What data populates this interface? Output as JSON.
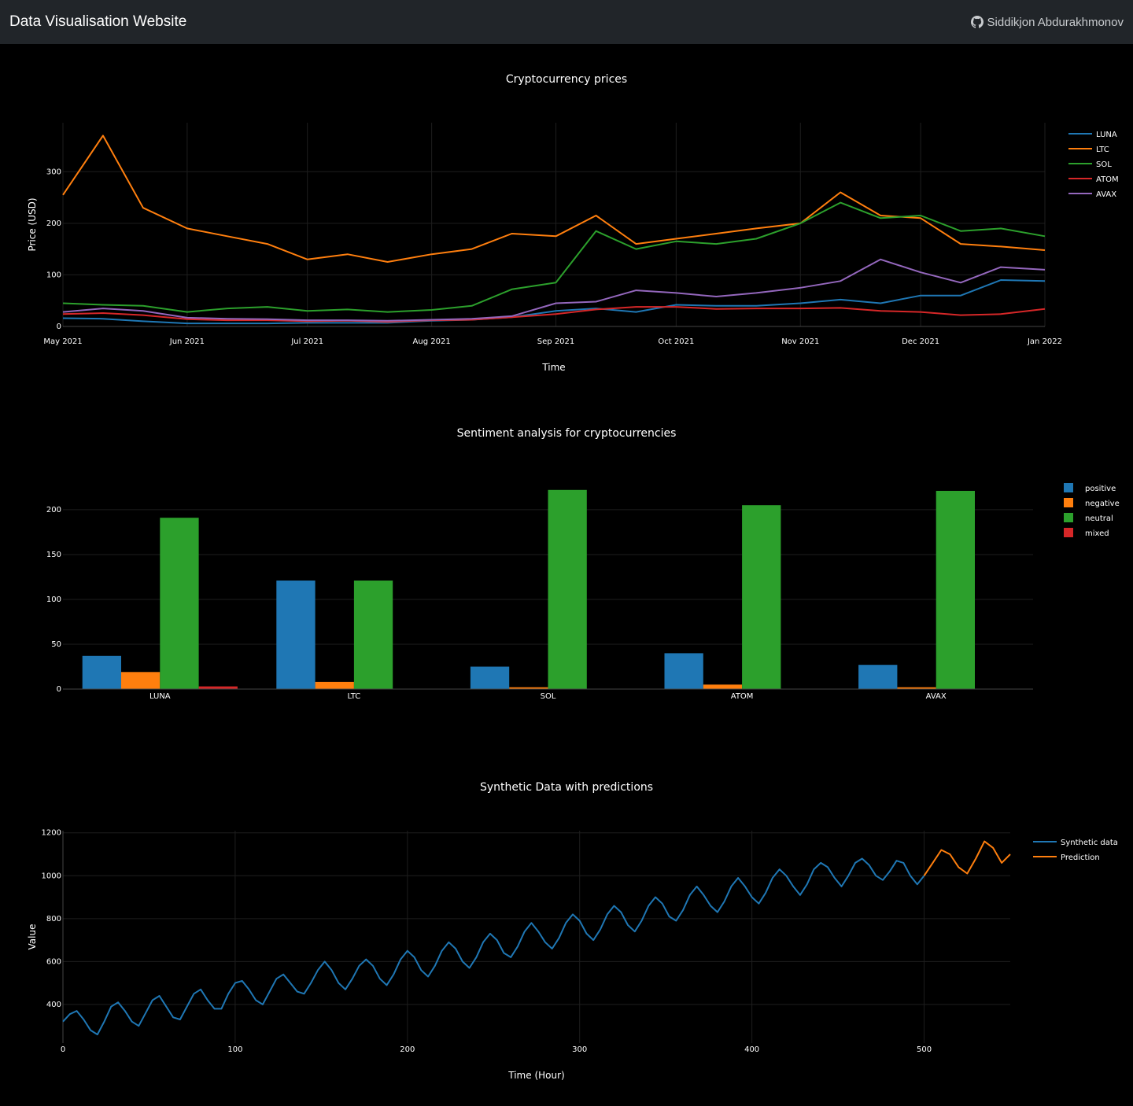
{
  "header": {
    "title": "Data Visualisation Website",
    "author": "Siddikjon Abdurakhmonov",
    "author_icon": "github-icon"
  },
  "colors": {
    "background": "#000000",
    "navbar": "#212529",
    "blue": "#1f77b4",
    "orange": "#ff7f0e",
    "green": "#2ca02c",
    "red": "#d62728",
    "purple": "#9467bd"
  },
  "charts": [
    {
      "id": "prices",
      "type": "line",
      "title": "Cryptocurrency prices",
      "xlabel": "Time",
      "ylabel": "Price (USD)",
      "x_range": [
        "2021-05-01",
        "2022-01-01"
      ],
      "ylim": [
        0,
        395
      ],
      "y_ticks": [
        0,
        100,
        200,
        300
      ],
      "x_ticks": [
        "May 2021",
        "Jun 2021",
        "Jul 2021",
        "Aug 2021",
        "Sep 2021",
        "Oct 2021",
        "Nov 2021",
        "Dec 2021",
        "Jan 2022"
      ],
      "x_tick_dates": [
        "2021-05-01",
        "2021-06-01",
        "2021-07-01",
        "2021-08-01",
        "2021-09-01",
        "2021-10-01",
        "2021-11-01",
        "2021-12-01",
        "2022-01-01"
      ],
      "grid": true,
      "legend_position": "right",
      "x": [
        "2021-05-01",
        "2021-05-11",
        "2021-05-21",
        "2021-06-01",
        "2021-06-11",
        "2021-06-21",
        "2021-07-01",
        "2021-07-11",
        "2021-07-21",
        "2021-08-01",
        "2021-08-11",
        "2021-08-21",
        "2021-09-01",
        "2021-09-11",
        "2021-09-21",
        "2021-10-01",
        "2021-10-11",
        "2021-10-21",
        "2021-11-01",
        "2021-11-11",
        "2021-11-21",
        "2021-12-01",
        "2021-12-11",
        "2021-12-21",
        "2022-01-01"
      ],
      "series": [
        {
          "name": "LUNA",
          "color": "#1f77b4",
          "values": [
            16,
            15,
            10,
            6,
            6,
            6,
            7,
            7,
            7,
            11,
            13,
            18,
            30,
            35,
            28,
            42,
            40,
            40,
            45,
            52,
            45,
            60,
            60,
            90,
            88
          ]
        },
        {
          "name": "LTC",
          "color": "#ff7f0e",
          "values": [
            255,
            370,
            230,
            190,
            175,
            160,
            130,
            140,
            125,
            140,
            150,
            180,
            175,
            215,
            160,
            170,
            180,
            190,
            200,
            260,
            215,
            210,
            160,
            155,
            148
          ]
        },
        {
          "name": "SOL",
          "color": "#2ca02c",
          "values": [
            45,
            42,
            40,
            28,
            35,
            38,
            30,
            33,
            28,
            32,
            40,
            72,
            85,
            185,
            150,
            165,
            160,
            170,
            200,
            240,
            210,
            215,
            185,
            190,
            175
          ]
        },
        {
          "name": "ATOM",
          "color": "#d62728",
          "values": [
            24,
            26,
            22,
            14,
            12,
            12,
            10,
            11,
            9,
            12,
            13,
            18,
            24,
            33,
            38,
            38,
            34,
            35,
            35,
            36,
            30,
            28,
            22,
            24,
            34
          ]
        },
        {
          "name": "AVAX",
          "color": "#9467bd",
          "values": [
            28,
            35,
            30,
            17,
            15,
            14,
            12,
            12,
            11,
            13,
            15,
            20,
            45,
            48,
            70,
            65,
            58,
            65,
            75,
            88,
            130,
            105,
            85,
            115,
            110
          ]
        }
      ]
    },
    {
      "id": "sentiment",
      "type": "bar",
      "title": "Sentiment analysis for cryptocurrencies",
      "categories": [
        "LUNA",
        "LTC",
        "SOL",
        "ATOM",
        "AVAX"
      ],
      "ylim": [
        0,
        228
      ],
      "y_ticks": [
        0,
        50,
        100,
        150,
        200
      ],
      "grid": true,
      "legend_position": "right",
      "series": [
        {
          "name": "positive",
          "color": "#1f77b4",
          "values": [
            37,
            121,
            25,
            40,
            27
          ]
        },
        {
          "name": "negative",
          "color": "#ff7f0e",
          "values": [
            19,
            8,
            2,
            5,
            2
          ]
        },
        {
          "name": "neutral",
          "color": "#2ca02c",
          "values": [
            191,
            121,
            222,
            205,
            221
          ]
        },
        {
          "name": "mixed",
          "color": "#d62728",
          "values": [
            3,
            0,
            0,
            0,
            0
          ]
        }
      ]
    },
    {
      "id": "synthetic",
      "type": "line",
      "title": "Synthetic Data with predictions",
      "xlabel": "Time (Hour)",
      "ylabel": "Value",
      "xlim": [
        0,
        550
      ],
      "ylim": [
        220,
        1210
      ],
      "x_ticks": [
        0,
        100,
        200,
        300,
        400,
        500
      ],
      "y_ticks": [
        400,
        600,
        800,
        1000,
        1200
      ],
      "grid": true,
      "legend_position": "right",
      "series": [
        {
          "name": "Synthetic data",
          "color": "#1f77b4",
          "x": [
            0,
            4,
            8,
            12,
            16,
            20,
            24,
            28,
            32,
            36,
            40,
            44,
            48,
            52,
            56,
            60,
            64,
            68,
            72,
            76,
            80,
            84,
            88,
            92,
            96,
            100,
            104,
            108,
            112,
            116,
            120,
            124,
            128,
            132,
            136,
            140,
            144,
            148,
            152,
            156,
            160,
            164,
            168,
            172,
            176,
            180,
            184,
            188,
            192,
            196,
            200,
            204,
            208,
            212,
            216,
            220,
            224,
            228,
            232,
            236,
            240,
            244,
            248,
            252,
            256,
            260,
            264,
            268,
            272,
            276,
            280,
            284,
            288,
            292,
            296,
            300,
            304,
            308,
            312,
            316,
            320,
            324,
            328,
            332,
            336,
            340,
            344,
            348,
            352,
            356,
            360,
            364,
            368,
            372,
            376,
            380,
            384,
            388,
            392,
            396,
            400,
            404,
            408,
            412,
            416,
            420,
            424,
            428,
            432,
            436,
            440,
            444,
            448,
            452,
            456,
            460,
            464,
            468,
            472,
            476,
            480,
            484,
            488,
            492,
            496,
            500
          ],
          "values": [
            320,
            355,
            370,
            330,
            280,
            260,
            320,
            390,
            410,
            370,
            320,
            300,
            360,
            420,
            440,
            390,
            340,
            330,
            390,
            450,
            470,
            420,
            380,
            380,
            450,
            500,
            510,
            470,
            420,
            400,
            460,
            520,
            540,
            500,
            460,
            450,
            500,
            560,
            600,
            560,
            500,
            470,
            520,
            580,
            610,
            580,
            520,
            490,
            540,
            610,
            650,
            620,
            560,
            530,
            580,
            650,
            690,
            660,
            600,
            570,
            620,
            690,
            730,
            700,
            640,
            620,
            670,
            740,
            780,
            740,
            690,
            660,
            710,
            780,
            820,
            790,
            730,
            700,
            750,
            820,
            860,
            830,
            770,
            740,
            790,
            860,
            900,
            870,
            810,
            790,
            840,
            910,
            950,
            910,
            860,
            830,
            880,
            950,
            990,
            950,
            900,
            870,
            920,
            990,
            1030,
            1000,
            950,
            910,
            960,
            1030,
            1060,
            1040,
            990,
            950,
            1000,
            1060,
            1080,
            1050,
            1000,
            980,
            1020,
            1070,
            1060,
            1000,
            960,
            1000
          ]
        },
        {
          "name": "Prediction",
          "color": "#ff7f0e",
          "x": [
            500,
            505,
            510,
            515,
            520,
            525,
            530,
            535,
            540,
            545,
            550
          ],
          "values": [
            1000,
            1060,
            1120,
            1100,
            1040,
            1010,
            1080,
            1160,
            1130,
            1060,
            1100
          ]
        }
      ]
    }
  ]
}
